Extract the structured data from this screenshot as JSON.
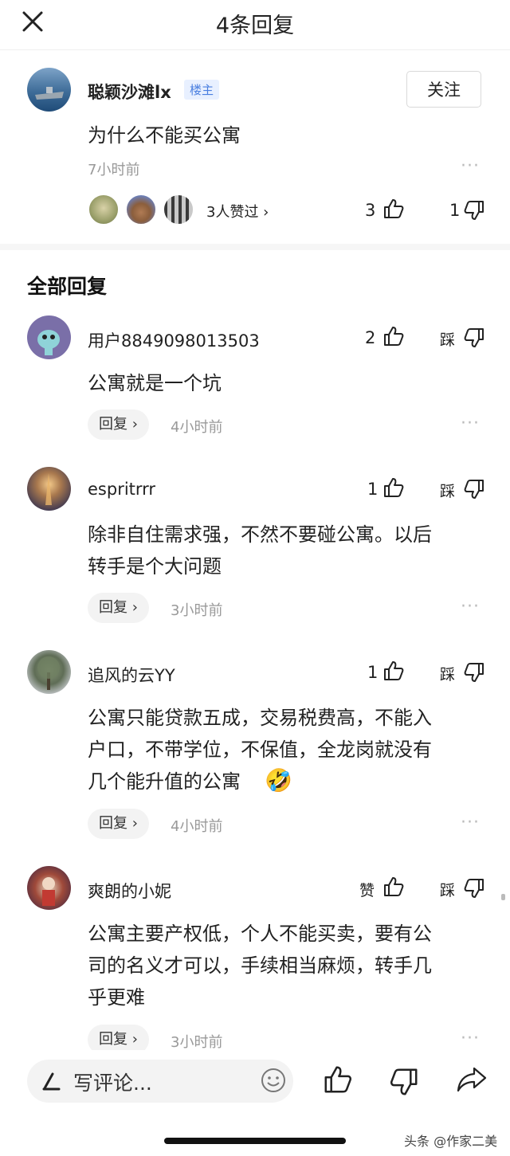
{
  "header": {
    "title": "4条回复"
  },
  "post": {
    "author": "聪颖沙滩lx",
    "badge": "楼主",
    "follow_label": "关注",
    "content": "为什么不能买公寓",
    "time": "7小时前",
    "liked_by": "3人赞过 ›",
    "like_count": "3",
    "dislike_count": "1"
  },
  "section_title": "全部回复",
  "replies": [
    {
      "user": "用户8849098013503",
      "like": "2",
      "dislike_label": "踩",
      "lines": [
        "公寓就是一个坑"
      ],
      "reply_label": "回复 ›",
      "time": "4小时前"
    },
    {
      "user": "espritrrr",
      "like": "1",
      "dislike_label": "踩",
      "lines": [
        "除非自住需求强，不然不要碰公寓。以后",
        "转手是个大问题"
      ],
      "reply_label": "回复 ›",
      "time": "3小时前"
    },
    {
      "user": "追风的云YY",
      "like": "1",
      "dislike_label": "踩",
      "lines": [
        "公寓只能贷款五成，交易税费高，不能入",
        "户口，不带学位，不保值，全龙岗就没有",
        "几个能升值的公寓"
      ],
      "emoji": "🤣",
      "reply_label": "回复 ›",
      "time": "4小时前"
    },
    {
      "user": "爽朗的小妮",
      "like": "赞",
      "dislike_label": "踩",
      "lines": [
        "公寓主要产权低，个人不能买卖，要有公",
        "司的名义才可以，手续相当麻烦，转手几",
        "乎更难"
      ],
      "reply_label": "回复 ›",
      "time": "3小时前"
    }
  ],
  "composer": {
    "placeholder": "写评论..."
  },
  "watermark": "头条 @作家二美",
  "icons": [
    "close-icon",
    "thumb-up-icon",
    "thumb-down-icon",
    "pen-icon",
    "emoji-icon",
    "share-icon",
    "more-icon"
  ]
}
